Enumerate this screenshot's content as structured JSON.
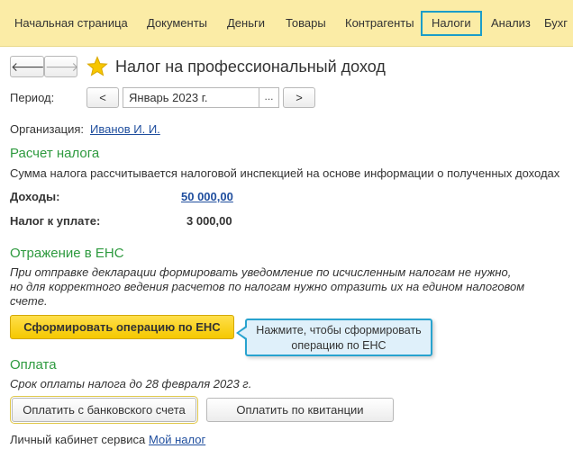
{
  "topmenu": {
    "items": [
      "Начальная страница",
      "Документы",
      "Деньги",
      "Товары",
      "Контрагенты",
      "Налоги",
      "Анализ",
      "Бухг"
    ],
    "active": "Налоги"
  },
  "header": {
    "back_glyph": "🡐",
    "forward_glyph": "🡒",
    "star_icon": "favorite-star-icon",
    "title": "Налог на профессиональный доход"
  },
  "period": {
    "label": "Период:",
    "prev": "<",
    "value": "Январь 2023 г.",
    "picker": "...",
    "next": ">"
  },
  "organization": {
    "label": "Организация:",
    "value": "Иванов И. И."
  },
  "tax_calc": {
    "title": "Расчет налога",
    "description": "Сумма налога рассчитывается налоговой инспекцией на основе информации о полученных доходах",
    "income_label": "Доходы:",
    "income_value": "50 000,00",
    "tax_label": "Налог к уплате:",
    "tax_value": "3 000,00"
  },
  "ens": {
    "title": "Отражение в ЕНС",
    "note_line1": "При отправке декларации формировать уведомление по исчисленным налогам не нужно,",
    "note_line2": "но для корректного ведения расчетов по налогам нужно отразить их на едином налоговом",
    "note_line3": "счете.",
    "button": "Сформировать операцию по ЕНС",
    "tooltip_line1": "Нажмите, чтобы сформировать",
    "tooltip_line2": "операцию по ЕНС"
  },
  "payment": {
    "title": "Оплата",
    "deadline": "Срок оплаты налога до 28 февраля 2023 г.",
    "bank_button": "Оплатить с банковского счета",
    "receipt_button": "Оплатить по квитанции"
  },
  "footer": {
    "label": "Личный кабинет сервиса",
    "link": "Мой налог"
  },
  "colors": {
    "menu_bg": "#fbeca6",
    "accent_blue": "#1b9dc9",
    "section_green": "#2e9a3f",
    "primary_yellow": "#f5c800",
    "link_blue": "#1f4e9e"
  }
}
